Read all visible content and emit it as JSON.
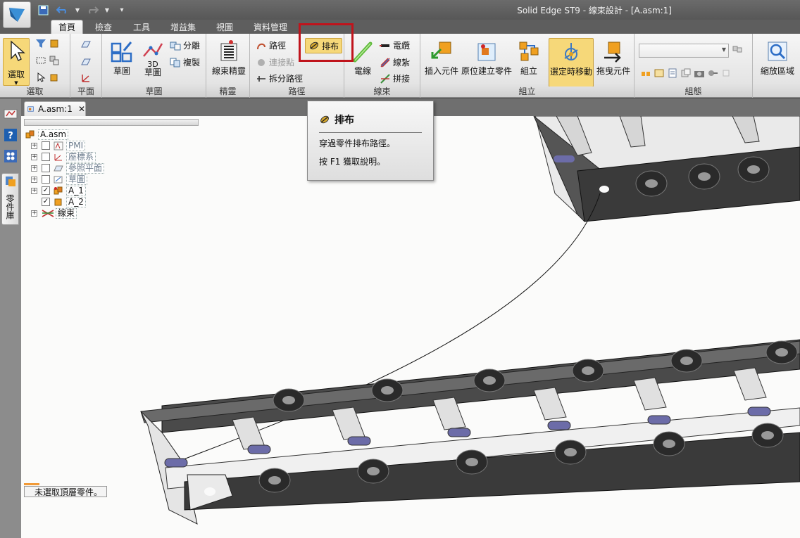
{
  "window": {
    "title": "Solid Edge ST9 - 線束設計 - [A.asm:1]"
  },
  "menu_tabs": [
    "首頁",
    "檢查",
    "工具",
    "增益集",
    "視圖",
    "資料管理"
  ],
  "ribbon": {
    "select": {
      "button": "選取",
      "group": "選取"
    },
    "plane": {
      "group": "平面"
    },
    "sketch": {
      "sketch": "草圖",
      "sketch3d_line1": "3D",
      "sketch3d_line2": "草圖",
      "separate": "分離",
      "copy": "複製",
      "group": "草圖"
    },
    "wizard": {
      "harness_wizard": "線束精靈",
      "group": "精靈"
    },
    "path": {
      "path": "路徑",
      "connection_point": "連接點",
      "split_path": "拆分路徑",
      "route": "排布",
      "group": "路徑"
    },
    "harness": {
      "wire": "電線",
      "cable": "電纜",
      "bundle": "線紮",
      "splice": "拼接",
      "group": "線束"
    },
    "assemble": {
      "insert_component": "插入元件",
      "create_in_place": "原位建立零件",
      "assemble": "組立",
      "move_selected": "選定時移動",
      "drag_component": "拖曳元件",
      "group": "組立"
    },
    "configurations": {
      "combo_value": "",
      "group": "組態"
    },
    "zoom": {
      "zoom_area": "縮放區域"
    }
  },
  "doc_tab": {
    "label": "A.asm:1"
  },
  "left_strip": {
    "parts_library_tab": "零件庫"
  },
  "pathfinder": {
    "root": "A.asm",
    "items": [
      {
        "label": "PMI",
        "checked": false
      },
      {
        "label": "座標系",
        "checked": false
      },
      {
        "label": "參照平面",
        "checked": false
      },
      {
        "label": "草圖",
        "checked": false
      },
      {
        "label": "A_1",
        "checked": true
      },
      {
        "label": "A_2",
        "checked": true
      },
      {
        "label": "線束"
      }
    ]
  },
  "tooltip": {
    "title": "排布",
    "description": "穿過零件排布路徑。",
    "help": "按 F1 獲取說明。"
  },
  "status": {
    "message": "未選取頂層零件。"
  },
  "colors": {
    "highlight": "#c0141c",
    "active_button": "#f6d879",
    "chain_link": "#3a3a3a",
    "pin": "#6c6ca8"
  }
}
